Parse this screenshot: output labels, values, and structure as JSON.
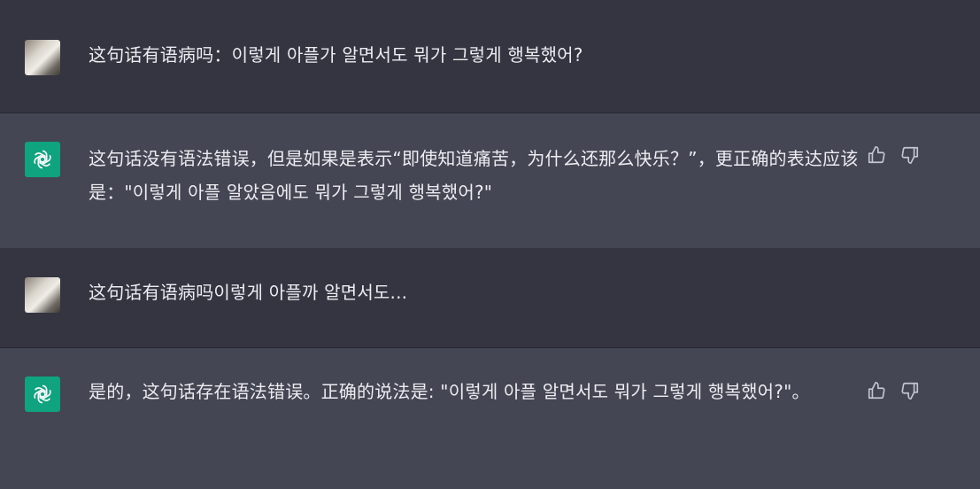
{
  "conversation": [
    {
      "role": "user",
      "avatar_icon": "user-avatar",
      "text": "这句话有语病吗：이렇게 아플가 알면서도 뭐가 그렇게 행복했어?"
    },
    {
      "role": "assistant",
      "avatar_icon": "openai-logo-icon",
      "text": "这句话没有语法错误，但是如果是表示“即使知道痛苦，为什么还那么快乐？”，更正确的表达应该是：\"이렇게 아플 알았음에도 뭐가 그렇게 행복했어?\"",
      "actions": [
        "thumbs-up-icon",
        "thumbs-down-icon"
      ]
    },
    {
      "role": "user",
      "avatar_icon": "user-avatar",
      "text": "这句话有语病吗이렇게 아플까 알면서도..."
    },
    {
      "role": "assistant",
      "avatar_icon": "openai-logo-icon",
      "text": "是的，这句话存在语法错误。正确的说法是: \"이렇게 아플 알면서도 뭐가 그렇게 행복했어?\"。",
      "actions": [
        "thumbs-up-icon",
        "thumbs-down-icon"
      ]
    }
  ],
  "colors": {
    "user_row_bg": "#343541",
    "assistant_row_bg": "#444654",
    "text": "#ececf1",
    "icon": "#c5c5d2",
    "gpt_logo_bg": "#10a37f"
  }
}
